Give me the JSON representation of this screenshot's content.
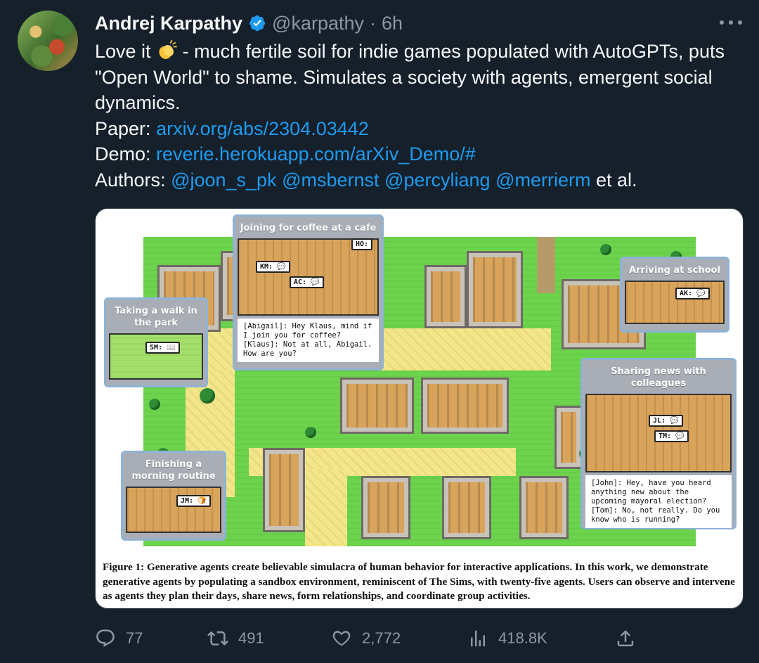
{
  "author": {
    "name": "Andrej Karpathy",
    "handle": "@karpathy",
    "separator": "·",
    "time": "6h",
    "verified_color": "#1d9bf0"
  },
  "tweet": {
    "line1_prefix": "Love it",
    "line1_emoji": "clapping-hands-icon",
    "line1_suffix": " - much fertile soil for indie games populated with AutoGPTs, puts \"Open World\" to shame. Simulates a society with agents, emergent social dynamics.",
    "paper_label": "Paper: ",
    "paper_link": "arxiv.org/abs/2304.03442",
    "demo_label": "Demo: ",
    "demo_link": "reverie.herokuapp.com/arXiv_Demo/#",
    "authors_label": "Authors: ",
    "authors": [
      "@joon_s_pk",
      "@msbernst",
      "@percyliang",
      "@merrierm"
    ],
    "authors_suffix": "et al."
  },
  "media": {
    "callouts": {
      "cafe": {
        "title": "Joining for coffee at a cafe",
        "bubbles": [
          "KM: 💬",
          "AC: 💬",
          "HO:"
        ],
        "dialog": "[Abigail]: Hey Klaus, mind if\nI join you for coffee?\n[Klaus]: Not at all, Abigail.\nHow are you?"
      },
      "park": {
        "title": "Taking a walk in the park",
        "bubbles": [
          "SM: 📖"
        ]
      },
      "school": {
        "title": "Arriving at school",
        "bubbles": [
          "AK: 💬"
        ]
      },
      "colleagues": {
        "title": "Sharing news with colleagues",
        "bubbles": [
          "JL: 💬",
          "TM: 💬"
        ],
        "dialog": "[John]: Hey, have you heard\nanything new about the\nupcoming mayoral election?\n[Tom]: No, not really. Do you\nknow who is running?"
      },
      "morning": {
        "title": "Finishing a morning routine",
        "bubbles": [
          "JM: 🍞"
        ]
      }
    },
    "caption": "Figure 1: Generative agents create believable simulacra of human behavior for interactive applications. In this work, we demonstrate generative agents by populating a sandbox environment, reminiscent of The Sims, with twenty-five agents. Users can observe and intervene as agents they plan their days, share news, form relationships, and coordinate group activities."
  },
  "actions": {
    "reply_count": "77",
    "retweet_count": "491",
    "like_count": "2,772",
    "views_count": "418.8K",
    "icons": [
      "reply-icon",
      "retweet-icon",
      "like-icon",
      "views-icon",
      "share-icon"
    ]
  }
}
